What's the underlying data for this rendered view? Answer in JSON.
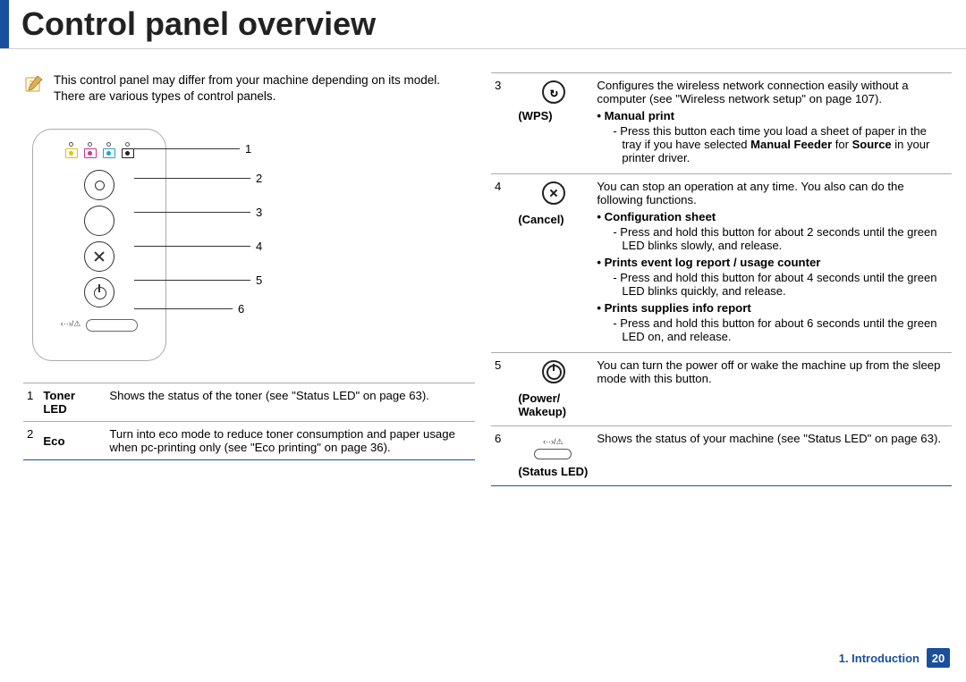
{
  "header": {
    "title": "Control panel overview"
  },
  "note": "This control panel may differ from your machine depending on its model. There are various types of control panels.",
  "callout_numbers": [
    "1",
    "2",
    "3",
    "4",
    "5",
    "6"
  ],
  "left_table": {
    "rows": [
      {
        "num": "1",
        "label": "Toner LED",
        "desc": "Shows the status of the toner (see \"Status LED\" on page 63)."
      },
      {
        "num": "2",
        "label": "Eco",
        "desc": "Turn into eco mode to reduce toner consumption and paper usage when pc-printing only (see \"Eco printing\" on page 36)."
      }
    ]
  },
  "right_table": {
    "row3": {
      "num": "3",
      "label": "(WPS)",
      "lead": "Configures the wireless network connection easily without a computer (see \"Wireless network setup\" on page 107).",
      "item_title": "Manual print",
      "item_body_pre": "Press this button each time you load a sheet of paper in the tray if you have selected ",
      "item_body_bold1": "Manual Feeder",
      "item_body_mid": " for ",
      "item_body_bold2": "Source",
      "item_body_post": " in your printer driver."
    },
    "row4": {
      "num": "4",
      "label": "(Cancel)",
      "lead": "You can stop an operation at any time. You also can do the following functions.",
      "i1_title": "Configuration sheet",
      "i1_body": "Press and hold this button for about 2 seconds until the green LED blinks slowly, and release.",
      "i2_title": "Prints event log report / usage counter",
      "i2_body": "Press and hold this button for about 4 seconds until the green LED blinks quickly, and release.",
      "i3_title": "Prints supplies info report",
      "i3_body": "Press and hold this button for about 6 seconds until the green LED on, and release."
    },
    "row5": {
      "num": "5",
      "label": "(Power/\nWakeup)",
      "desc": "You can turn the power off or wake the machine up from the sleep mode with this button."
    },
    "row6": {
      "num": "6",
      "label": "(Status LED)",
      "desc": "Shows the status of your machine (see \"Status LED\" on page 63)."
    }
  },
  "footer": {
    "section": "1. Introduction",
    "page": "20"
  },
  "status_glyph": "‹··›/⚠"
}
